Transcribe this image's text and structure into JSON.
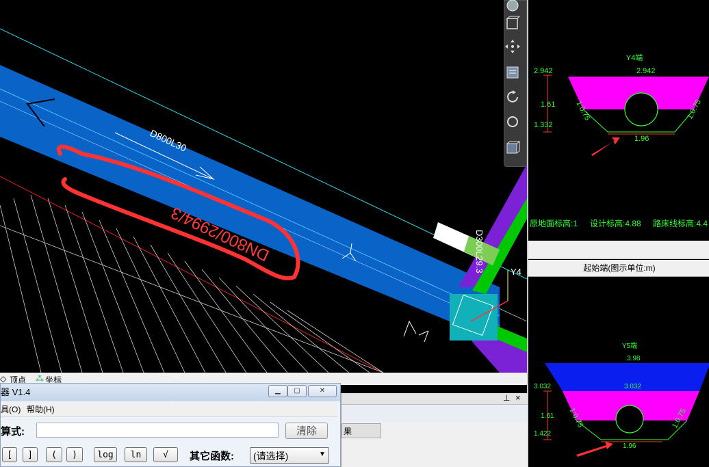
{
  "cad": {
    "pipe_label": "D800L30",
    "annot_label": "DN800/2994/3",
    "side_pipe_label": "D300L29.3",
    "node_label": "Y4",
    "colors": {
      "pipe": "#0a64c8",
      "cyan": "#33d6e6",
      "red_annot": "#ff3b3b",
      "green": "#00c800",
      "purple": "#7b22d6"
    }
  },
  "toolbar": {
    "icons": [
      "orbit-icon",
      "view-cube-icon",
      "pan-icon",
      "zoom-extents-icon",
      "rotate-icon",
      "circle-icon",
      "box-icon"
    ]
  },
  "section_top": {
    "title": "Y4端",
    "left_top": "2.942",
    "top_center": "2.942",
    "dim_mid": "1.61",
    "dim_bottom": "1.332",
    "slope_left": "1:0.75",
    "slope_right": "1:0.75",
    "bottom_width": "1.96"
  },
  "info_row": {
    "ground": "原地面标高:1",
    "design": "设计标高:4.88",
    "roadbed": "路床线标高:4.4"
  },
  "section_header": "起始端(图示单位:m)",
  "section_bottom": {
    "title": "Y5端",
    "top_center": "3.98",
    "left_top": "3.032",
    "mid_center": "3.032",
    "dim_mid": "1.61",
    "dim_bottom": "1.422",
    "slope_left": "1:0.75",
    "slope_right": "1:0.75",
    "bottom_width": "1.96"
  },
  "tabs": {
    "vertex": "顶点",
    "coords": "坐标"
  },
  "calc": {
    "title": "器 V1.4",
    "menu_tools": "具(O)",
    "menu_help": "帮助(H)",
    "expr_label": "算式:",
    "expr_value": "",
    "clear_label": "清除",
    "buttons": [
      "[",
      "]",
      "(",
      ")",
      "log",
      "ln",
      "√"
    ],
    "other_label": "其它函数:",
    "select_value": "(请选择)"
  },
  "docked": {
    "result_tab": "果",
    "pin": "ᵽ",
    "close": "×"
  }
}
